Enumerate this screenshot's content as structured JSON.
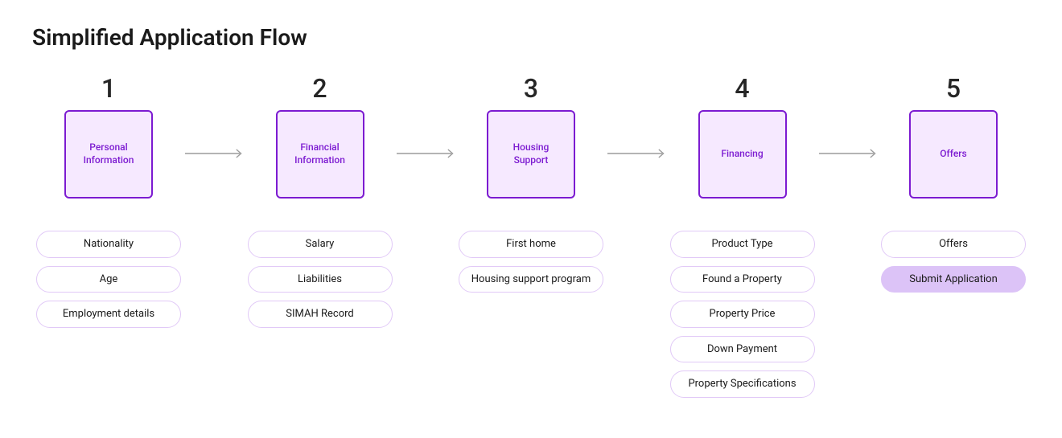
{
  "title": "Simplified Application Flow",
  "steps": [
    {
      "number": "1",
      "label": "Personal Information"
    },
    {
      "number": "2",
      "label": "Financial Information"
    },
    {
      "number": "3",
      "label": "Housing Support"
    },
    {
      "number": "4",
      "label": "Financing"
    },
    {
      "number": "5",
      "label": "Offers"
    }
  ],
  "details": [
    [
      {
        "text": "Nationality",
        "filled": false
      },
      {
        "text": "Age",
        "filled": false
      },
      {
        "text": "Employment details",
        "filled": false
      }
    ],
    [
      {
        "text": "Salary",
        "filled": false
      },
      {
        "text": "Liabilities",
        "filled": false
      },
      {
        "text": "SIMAH Record",
        "filled": false
      }
    ],
    [
      {
        "text": "First home",
        "filled": false
      },
      {
        "text": "Housing support program",
        "filled": false
      }
    ],
    [
      {
        "text": "Product Type",
        "filled": false
      },
      {
        "text": "Found a Property",
        "filled": false
      },
      {
        "text": "Property Price",
        "filled": false
      },
      {
        "text": "Down Payment",
        "filled": false
      },
      {
        "text": "Property Specifications",
        "filled": false
      }
    ],
    [
      {
        "text": "Offers",
        "filled": false
      },
      {
        "text": "Submit Application",
        "filled": true
      }
    ]
  ],
  "colors": {
    "box_border": "#7c1bd1",
    "box_fill": "#f6e9ff",
    "pill_border": "#e1c9f7",
    "pill_filled": "#dcc3f7",
    "arrow": "#9b9b9b"
  }
}
